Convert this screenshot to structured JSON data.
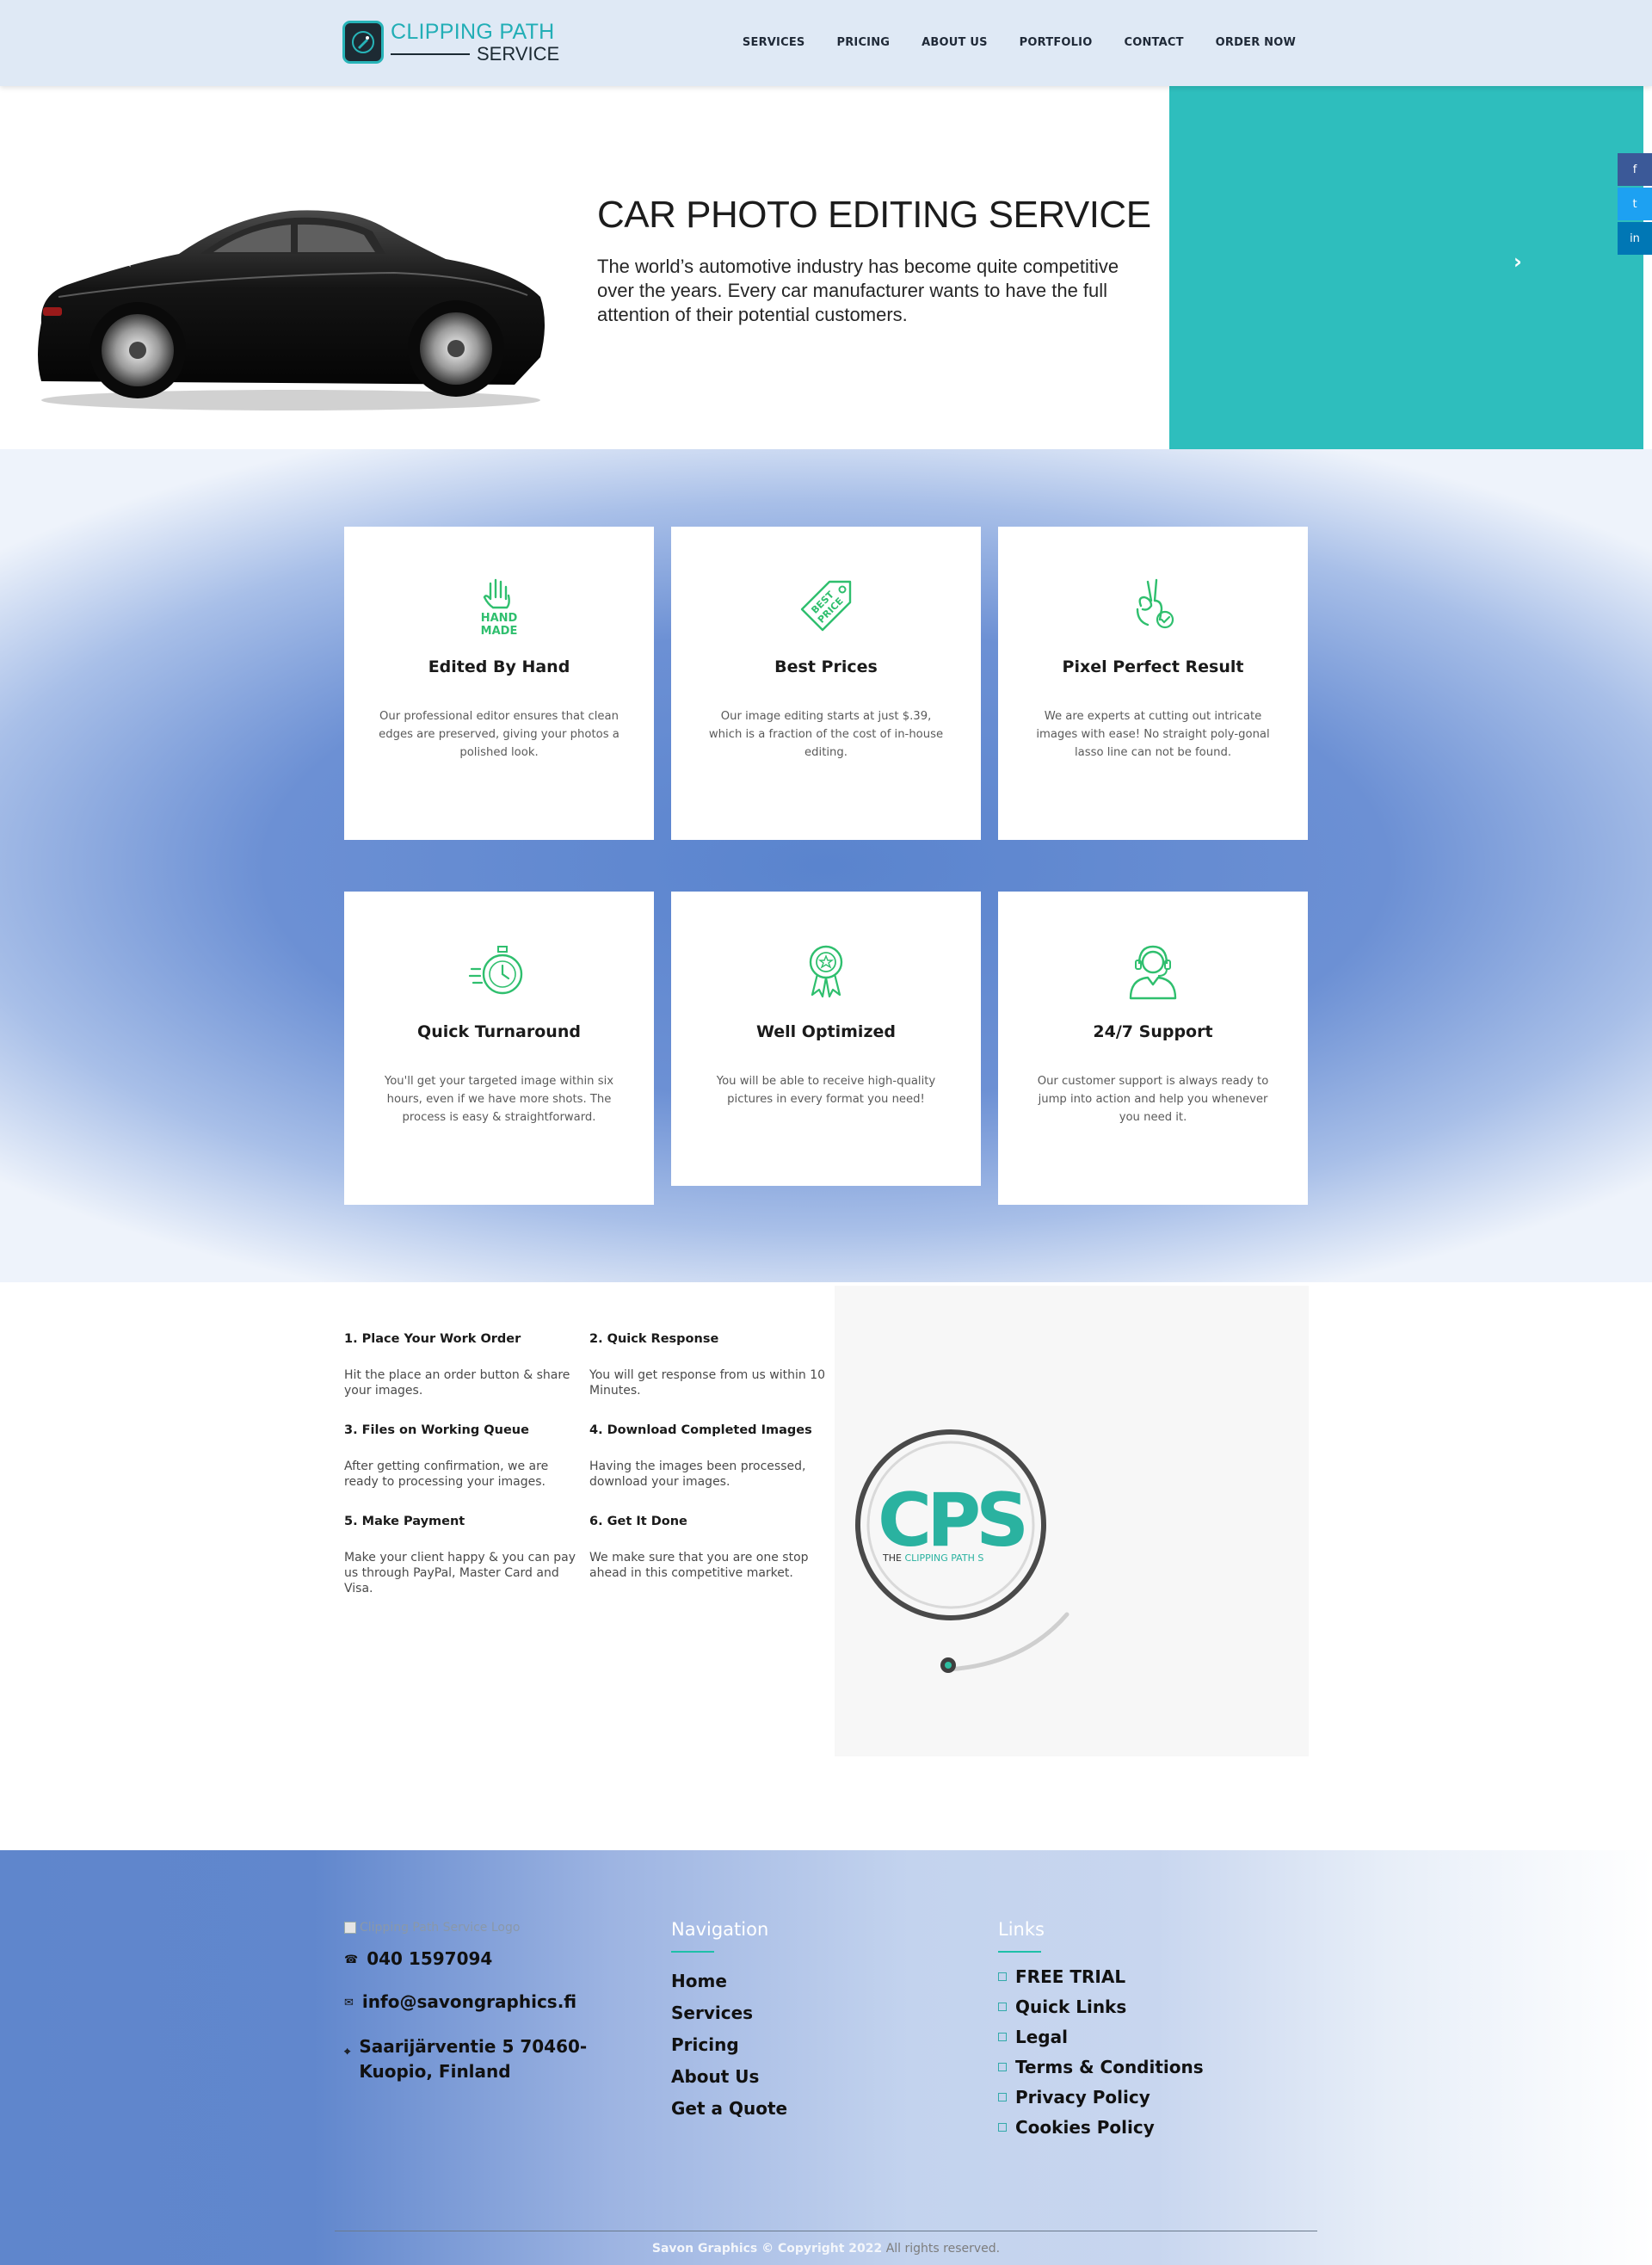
{
  "header": {
    "logo_line1": "CLIPPING PATH",
    "logo_line2": "SERVICE",
    "nav": [
      "SERVICES",
      "PRICING",
      "ABOUT US",
      "PORTFOLIO",
      "CONTACT",
      "ORDER NOW"
    ]
  },
  "hero": {
    "title": "CAR PHOTO EDITING SERVICE",
    "description": "The world’s automotive industry has become quite competitive over the years. Every car manufacturer wants to have the full attention of their potential customers.",
    "accent_color": "#2ebebd",
    "prev_icon": "chevron-left-icon",
    "next_icon": "chevron-right-icon"
  },
  "social": {
    "colors": [
      "#3b5998",
      "#1da1f2",
      "#0077b5"
    ],
    "icons": [
      "facebook-icon",
      "twitter-icon",
      "linkedin-icon"
    ]
  },
  "features": [
    {
      "icon": "hand-made-icon",
      "icon_text": [
        "HAND",
        "MADE"
      ],
      "title": "Edited By Hand",
      "text": "Our professional editor ensures that clean edges are preserved, giving your photos a polished look."
    },
    {
      "icon": "best-price-tag-icon",
      "icon_text": [
        "BEST",
        "PRICE"
      ],
      "title": "Best Prices",
      "text": "Our image editing starts at just $.39, which is a fraction of the cost of in-house editing."
    },
    {
      "icon": "ok-hand-icon",
      "title": "Pixel Perfect Result",
      "text": "We are experts at cutting out intricate images with ease! No straight poly-gonal lasso line can not be found."
    },
    {
      "icon": "stopwatch-icon",
      "title": "Quick Turnaround",
      "text": "You'll get your targeted image within six hours, even if we have more shots. The process is easy & straightforward."
    },
    {
      "icon": "award-badge-icon",
      "title": "Well Optimized",
      "text": "You will be able to receive high-quality pictures in every format you need!"
    },
    {
      "icon": "support-agent-icon",
      "title": "24/7 Support",
      "text": "Our customer support is always ready to jump into action and help you whenever you need it."
    }
  ],
  "feature_icon_color": "#2fbf6e",
  "steps": [
    {
      "title": "1. Place Your Work Order",
      "text": "Hit the place an order button & share your images."
    },
    {
      "title": "2. Quick Response",
      "text": "You will get response from us within 10 Minutes."
    },
    {
      "title": "3. Files on Working Queue",
      "text": "After getting confirmation, we are ready to processing your images."
    },
    {
      "title": "4. Download Completed Images",
      "text": "Having the images been processed, download your images."
    },
    {
      "title": "5. Make Payment",
      "text": "Make your client happy & you can pay us through PayPal, Master Card and Visa."
    },
    {
      "title": "6. Get It Done",
      "text": "We make sure that you are one stop ahead in this competitive market."
    }
  ],
  "cps_logo": {
    "letters": "CPS",
    "tagline_prefix": "THE ",
    "tagline_colored": "CLIPPING PATH S"
  },
  "footer": {
    "logo_alt": "Clipping Path Service Logo",
    "phone": "040 1597094",
    "email": "info@savongraphics.fi",
    "address": "Saarijärventie 5 70460- Kuopio, Finland",
    "navigation_heading": "Navigation",
    "navigation": [
      "Home",
      "Services",
      "Pricing",
      "About Us",
      "Get a Quote"
    ],
    "links_heading": "Links",
    "links": [
      "FREE TRIAL",
      "Quick Links",
      "Legal",
      "Terms & Conditions",
      "Privacy Policy",
      "Cookies Policy"
    ],
    "copyright": "Savon Graphics © Copyright 2022",
    "rights": " All rights reserved."
  }
}
